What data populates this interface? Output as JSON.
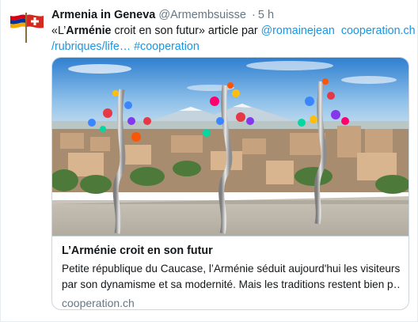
{
  "tweet": {
    "display_name": "Armenia in Geneva",
    "handle": "@Armembsuisse",
    "separator": "·",
    "time": "5 h",
    "text": {
      "open_quote": "«L’",
      "bold_word": "Arménie",
      "after_bold": " croit en son futur» article par ",
      "mention": "@romainejean",
      "link_part1": "cooperation.ch",
      "link_part2": "/rubriques/life…",
      "hashtag": "#cooperation"
    }
  },
  "card": {
    "title": "L’Arménie croit en son futur",
    "description_line1": "Petite république du Caucase, l’Arménie séduit aujourd'hui les visiteurs",
    "description_line2": "par son dynamisme et sa modernité. Mais les traditions restent bien p…",
    "domain": "cooperation.ch"
  },
  "colors": {
    "link": "#1b95e0",
    "secondary_text": "#657786",
    "border": "#ccd6dd",
    "flag_armenia": [
      "#d90012",
      "#0033a0",
      "#f2a800"
    ],
    "flag_switzerland": "#d52b1e"
  },
  "icons": {
    "avatar": "armenia-switzerland-flags-icon"
  }
}
